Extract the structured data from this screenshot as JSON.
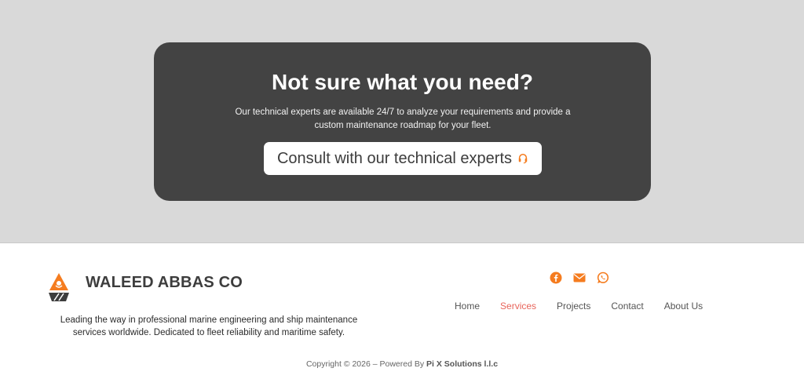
{
  "cta": {
    "title": "Not sure what you need?",
    "text": "Our technical experts are available 24/7 to analyze your requirements and provide a custom maintenance roadmap for your fleet.",
    "button_label": "Consult with our technical experts",
    "button_icon": "headset-icon"
  },
  "footer": {
    "brand": "WALEED ABBAS CO",
    "logo_icon": "ship-logo-icon",
    "description": "Leading the way in professional marine engineering and ship maintenance services worldwide. Dedicated to fleet reliability and maritime safety.",
    "social": [
      "facebook-icon",
      "email-icon",
      "whatsapp-icon"
    ],
    "nav": [
      {
        "label": "Home",
        "active": false
      },
      {
        "label": "Services",
        "active": true
      },
      {
        "label": "Projects",
        "active": false
      },
      {
        "label": "Contact",
        "active": false
      },
      {
        "label": "About Us",
        "active": false
      }
    ],
    "copyright_prefix": "Copyright © 2026 – Powered By",
    "copyright_company": "Pi X Solutions l.l.c"
  },
  "colors": {
    "accent": "#f57c1f",
    "active_nav": "#e8645a",
    "card_bg": "#434343",
    "page_bg": "#d9d9d9"
  }
}
